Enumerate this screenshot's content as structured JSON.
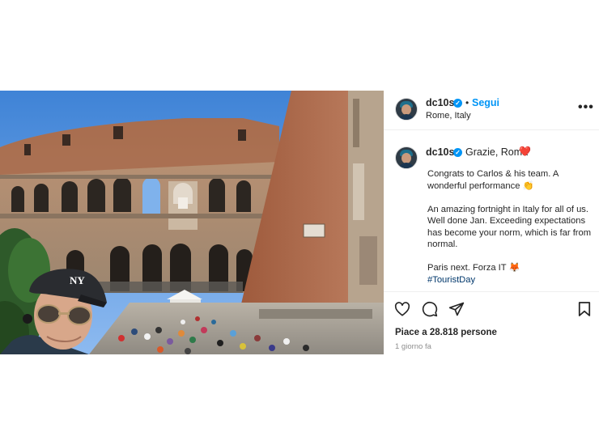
{
  "post": {
    "username": "dc10s",
    "follow_label": "Segui",
    "separator": "•",
    "location": "Rome, Italy",
    "more_icon": "more-options-icon",
    "caption_username": "dc10s",
    "caption_title": "Grazie, Roma",
    "caption_heart": "❤️",
    "caption_paragraph_1": "Congrats to Carlos & his team. A wonderful performance 👏",
    "caption_paragraph_2": "An amazing fortnight in Italy for all of us. Well done Jan. Exceeding expectations has become your norm, which is far from normal.",
    "caption_paragraph_3": "Paris next. Forza IT 🦊",
    "hashtag": "#TouristDay",
    "likes_text": "Piace a 28.818 persone",
    "time_ago": "1 giorno fa",
    "photo_cap_logo": "NY",
    "icons": {
      "like": "heart-icon",
      "comment": "comment-icon",
      "share": "share-icon",
      "save": "bookmark-icon",
      "verified": "verified-badge-icon"
    },
    "colors": {
      "accent": "#0095f6",
      "heart": "#ed4956",
      "text": "#262626",
      "muted": "#8e8e8e",
      "hashtag": "#00376b"
    }
  }
}
